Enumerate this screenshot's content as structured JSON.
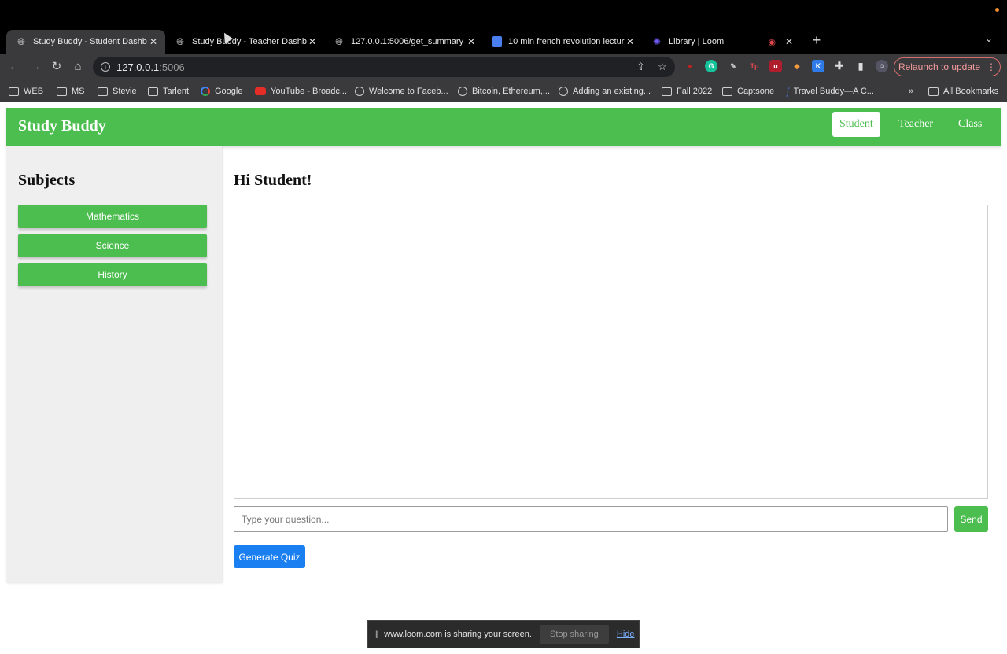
{
  "browser": {
    "tabs": [
      {
        "title": "Study Buddy - Student Dashb",
        "icon": "globe-icon",
        "active": true
      },
      {
        "title": "Study Buddy - Teacher Dashb",
        "icon": "globe-icon",
        "active": false
      },
      {
        "title": "127.0.0.1:5006/get_summary",
        "icon": "globe-icon",
        "active": false
      },
      {
        "title": "10 min french revolution lectur",
        "icon": "doc-icon",
        "active": false
      },
      {
        "title": "Library | Loom",
        "icon": "loom-icon",
        "active": false
      }
    ],
    "new_tab_label": "+",
    "address": {
      "host": "127.0.0.1",
      "port": ":5006"
    },
    "relaunch_label": "Relaunch to update",
    "bookmarks": [
      {
        "label": "WEB",
        "icon": "folder-icon"
      },
      {
        "label": "MS",
        "icon": "folder-icon"
      },
      {
        "label": "Stevie",
        "icon": "folder-icon"
      },
      {
        "label": "Tarlent",
        "icon": "folder-icon"
      },
      {
        "label": "Google",
        "icon": "google-icon"
      },
      {
        "label": "YouTube - Broadc...",
        "icon": "youtube-icon"
      },
      {
        "label": "Welcome to Faceb...",
        "icon": "globe-icon"
      },
      {
        "label": "Bitcoin, Ethereum,...",
        "icon": "globe-icon"
      },
      {
        "label": "Adding an existing...",
        "icon": "github-icon"
      },
      {
        "label": "Fall 2022",
        "icon": "folder-icon"
      },
      {
        "label": "Captsone",
        "icon": "folder-icon"
      },
      {
        "label": "Travel Buddy—A C...",
        "icon": "link-icon"
      }
    ],
    "bookmarks_overflow": "»",
    "all_bookmarks_label": "All Bookmarks"
  },
  "app": {
    "brand": "Study Buddy",
    "nav": [
      {
        "label": "Student",
        "active": true
      },
      {
        "label": "Teacher",
        "active": false
      },
      {
        "label": "Class",
        "active": false
      }
    ],
    "sidebar": {
      "title": "Subjects",
      "subjects": [
        "Mathematics",
        "Science",
        "History"
      ]
    },
    "main": {
      "greeting": "Hi Student!",
      "input_placeholder": "Type your question...",
      "send_label": "Send",
      "quiz_label": "Generate Quiz"
    },
    "colors": {
      "accent_green": "#4cbd4f",
      "quiz_blue": "#1a7ff0"
    }
  },
  "share_banner": {
    "message": "www.loom.com is sharing your screen.",
    "stop_label": "Stop sharing",
    "hide_label": "Hide"
  }
}
